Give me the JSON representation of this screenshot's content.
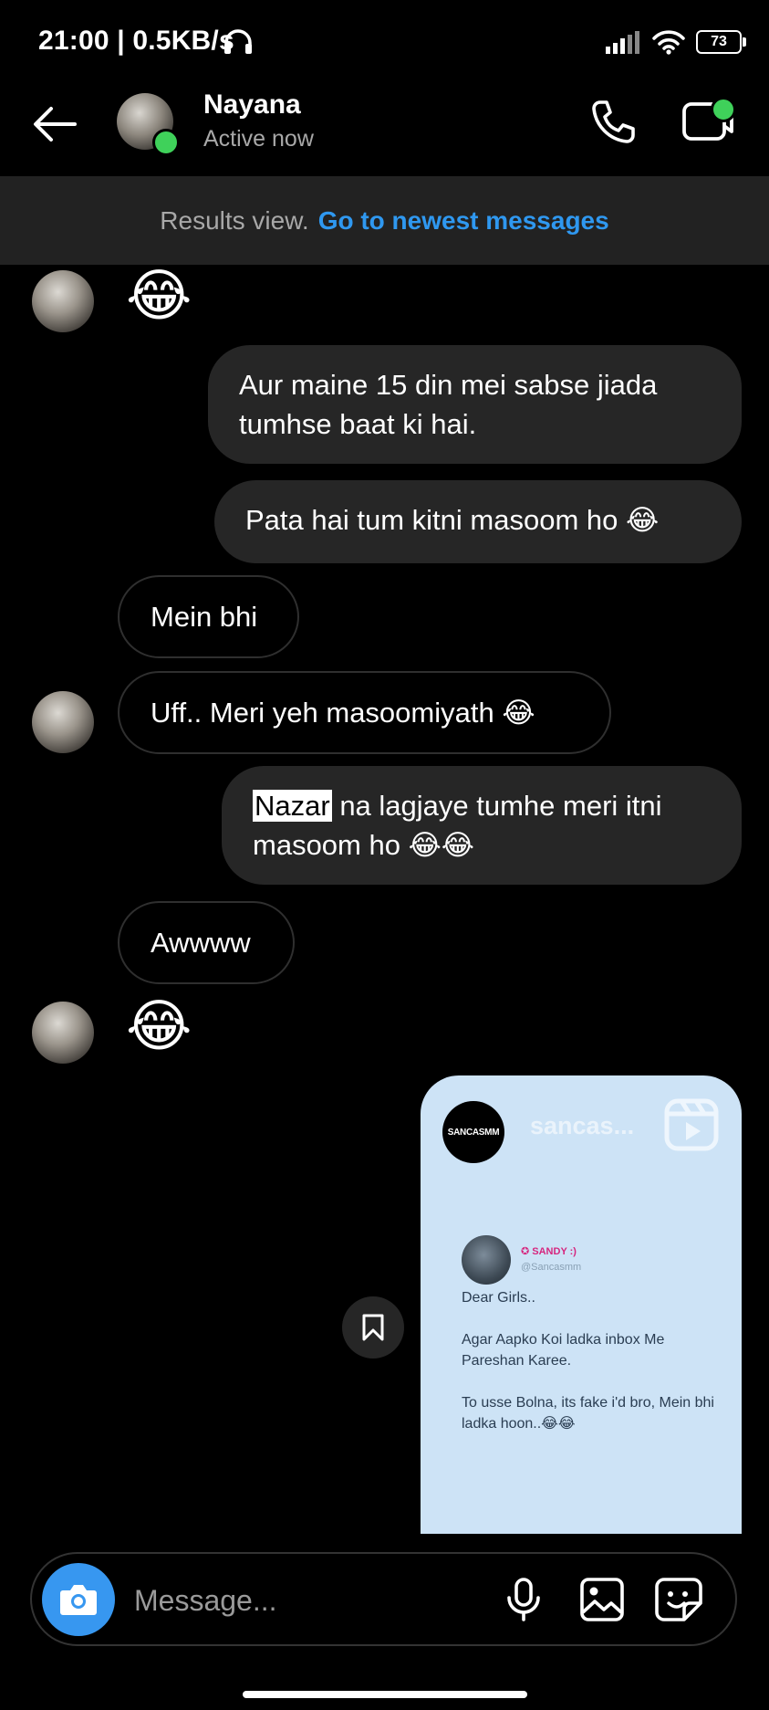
{
  "status_bar": {
    "time_speed": "21:00 | 0.5KB/s",
    "battery": "73"
  },
  "header": {
    "contact_name": "Nayana",
    "contact_status": "Active now"
  },
  "banner": {
    "text": "Results view.",
    "link": "Go to newest messages"
  },
  "messages": {
    "m1_emoji": "😂",
    "m2": "Aur maine 15 din mei sabse jiada tumhse baat ki hai.",
    "m3": "Pata hai tum kitni masoom ho 😂",
    "m4": "Mein bhi",
    "m5": "Uff.. Meri yeh masoomiyath 😂",
    "m6_highlight": "Nazar",
    "m6_rest": " na lagjaye tumhe meri itni masoom ho 😂😂",
    "m7": "Awwww",
    "m8_emoji": "😂"
  },
  "shared_reel": {
    "logo_text": "SANCASMM",
    "username": "sancas...",
    "tweet_name": "✪ SANDY :)",
    "tweet_handle": "@Sancasmm",
    "tweet_text": "Dear Girls..\n\nAgar Aapko Koi ladka inbox Me Pareshan Karee.\n\nTo usse Bolna, its fake i'd bro, Mein bhi ladka hoon..😂😂"
  },
  "composer": {
    "placeholder": "Message..."
  },
  "colors": {
    "accent": "#3797f0",
    "link": "#2f98f0",
    "online": "#3fd15a",
    "bubble_out": "#262626",
    "reel_bg": "#cde3f6"
  }
}
